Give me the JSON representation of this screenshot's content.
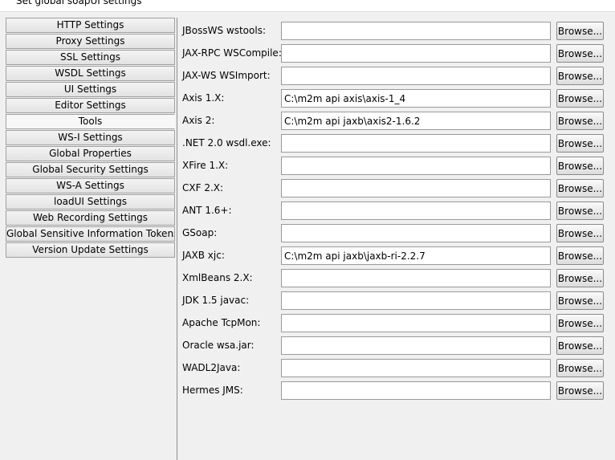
{
  "window": {
    "title": "Set global soapUI settings"
  },
  "sidebar": {
    "selected_index": 6,
    "items": [
      {
        "label": "HTTP Settings"
      },
      {
        "label": "Proxy Settings"
      },
      {
        "label": "SSL Settings"
      },
      {
        "label": "WSDL Settings"
      },
      {
        "label": "UI Settings"
      },
      {
        "label": "Editor Settings"
      },
      {
        "label": "Tools"
      },
      {
        "label": "WS-I Settings"
      },
      {
        "label": "Global Properties"
      },
      {
        "label": "Global Security Settings"
      },
      {
        "label": "WS-A Settings"
      },
      {
        "label": "loadUI Settings"
      },
      {
        "label": "Web Recording Settings"
      },
      {
        "label": "Global Sensitive Information Tokens"
      },
      {
        "label": "Version Update Settings"
      }
    ]
  },
  "tools": {
    "browse_label": "Browse...",
    "rows": [
      {
        "label": "JBossWS wstools:",
        "value": ""
      },
      {
        "label": "JAX-RPC WSCompile:",
        "value": ""
      },
      {
        "label": "JAX-WS WSImport:",
        "value": ""
      },
      {
        "label": "Axis 1.X:",
        "value": "C:\\m2m api axis\\axis-1_4"
      },
      {
        "label": "Axis 2:",
        "value": "C:\\m2m api jaxb\\axis2-1.6.2"
      },
      {
        "label": ".NET 2.0 wsdl.exe:",
        "value": ""
      },
      {
        "label": "XFire 1.X:",
        "value": ""
      },
      {
        "label": "CXF 2.X:",
        "value": ""
      },
      {
        "label": "ANT 1.6+:",
        "value": ""
      },
      {
        "label": "GSoap:",
        "value": ""
      },
      {
        "label": "JAXB xjc:",
        "value": "C:\\m2m api jaxb\\jaxb-ri-2.2.7"
      },
      {
        "label": "XmlBeans 2.X:",
        "value": ""
      },
      {
        "label": "JDK 1.5 javac:",
        "value": ""
      },
      {
        "label": "Apache TcpMon:",
        "value": ""
      },
      {
        "label": "Oracle wsa.jar:",
        "value": ""
      },
      {
        "label": "WADL2Java:",
        "value": ""
      },
      {
        "label": "Hermes JMS:",
        "value": ""
      }
    ]
  }
}
